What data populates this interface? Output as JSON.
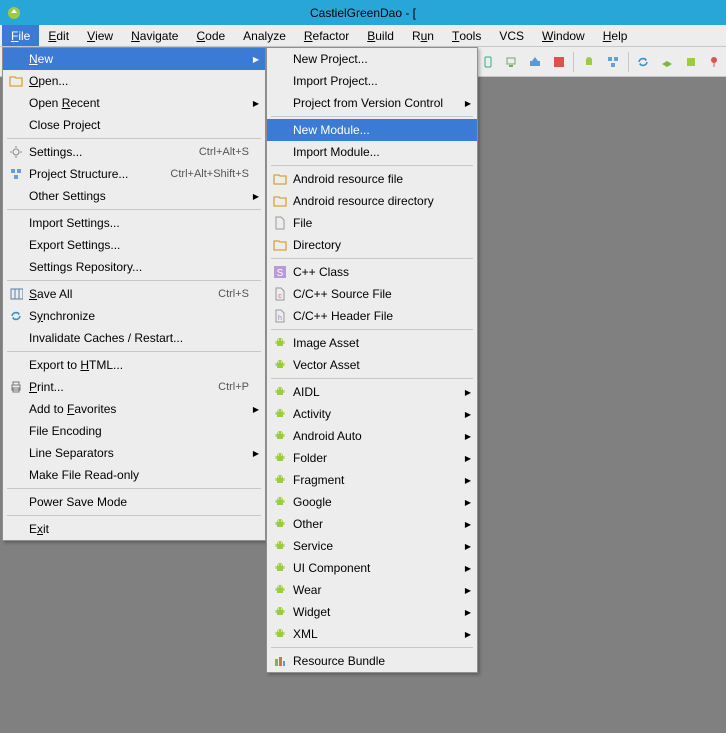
{
  "title": "CastielGreenDao - [",
  "menubar": [
    "File",
    "Edit",
    "View",
    "Navigate",
    "Code",
    "Analyze",
    "Refactor",
    "Build",
    "Run",
    "Tools",
    "VCS",
    "Window",
    "Help"
  ],
  "menubar_mn": [
    "F",
    "E",
    "V",
    "N",
    "C",
    null,
    "R",
    "B",
    "u",
    "T",
    null,
    "W",
    "H"
  ],
  "file_menu": [
    {
      "icon": "none",
      "label": "New",
      "mn": "N",
      "shortcut": "",
      "arrow": true,
      "hl": true
    },
    {
      "icon": "folder",
      "label": "Open...",
      "mn": "O",
      "shortcut": "",
      "arrow": false
    },
    {
      "icon": "none",
      "label": "Open Recent",
      "mn": "R",
      "shortcut": "",
      "arrow": true
    },
    {
      "icon": "none",
      "label": "Close Project",
      "mn": "",
      "shortcut": "",
      "arrow": false
    },
    {
      "sep": true
    },
    {
      "icon": "gear",
      "label": "Settings...",
      "mn": "",
      "shortcut": "Ctrl+Alt+S",
      "arrow": false
    },
    {
      "icon": "struct",
      "label": "Project Structure...",
      "mn": "",
      "shortcut": "Ctrl+Alt+Shift+S",
      "arrow": false
    },
    {
      "icon": "none",
      "label": "Other Settings",
      "mn": "",
      "shortcut": "",
      "arrow": true
    },
    {
      "sep": true
    },
    {
      "icon": "none",
      "label": "Import Settings...",
      "mn": "",
      "shortcut": "",
      "arrow": false
    },
    {
      "icon": "none",
      "label": "Export Settings...",
      "mn": "",
      "shortcut": "",
      "arrow": false
    },
    {
      "icon": "none",
      "label": "Settings Repository...",
      "mn": "",
      "shortcut": "",
      "arrow": false
    },
    {
      "sep": true
    },
    {
      "icon": "save",
      "label": "Save All",
      "mn": "S",
      "shortcut": "Ctrl+S",
      "arrow": false
    },
    {
      "icon": "sync",
      "label": "Synchronize",
      "mn": "y",
      "shortcut": "",
      "arrow": false
    },
    {
      "icon": "none",
      "label": "Invalidate Caches / Restart...",
      "mn": "",
      "shortcut": "",
      "arrow": false
    },
    {
      "sep": true
    },
    {
      "icon": "none",
      "label": "Export to HTML...",
      "mn": "H",
      "shortcut": "",
      "arrow": false
    },
    {
      "icon": "print",
      "label": "Print...",
      "mn": "P",
      "shortcut": "Ctrl+P",
      "arrow": false
    },
    {
      "icon": "none",
      "label": "Add to Favorites",
      "mn": "F",
      "shortcut": "",
      "arrow": true
    },
    {
      "icon": "none",
      "label": "File Encoding",
      "mn": "",
      "shortcut": "",
      "arrow": false
    },
    {
      "icon": "none",
      "label": "Line Separators",
      "mn": "",
      "shortcut": "",
      "arrow": true
    },
    {
      "icon": "none",
      "label": "Make File Read-only",
      "mn": "",
      "shortcut": "",
      "arrow": false
    },
    {
      "sep": true
    },
    {
      "icon": "none",
      "label": "Power Save Mode",
      "mn": "",
      "shortcut": "",
      "arrow": false
    },
    {
      "sep": true
    },
    {
      "icon": "none",
      "label": "Exit",
      "mn": "x",
      "shortcut": "",
      "arrow": false
    }
  ],
  "new_menu": [
    {
      "icon": "none",
      "label": "New Project...",
      "arrow": false
    },
    {
      "icon": "none",
      "label": "Import Project...",
      "arrow": false
    },
    {
      "icon": "none",
      "label": "Project from Version Control",
      "arrow": true
    },
    {
      "sep": true
    },
    {
      "icon": "none",
      "label": "New Module...",
      "arrow": false,
      "hl": true
    },
    {
      "icon": "none",
      "label": "Import Module...",
      "arrow": false
    },
    {
      "sep": true
    },
    {
      "icon": "folder",
      "label": "Android resource file",
      "arrow": false
    },
    {
      "icon": "folder",
      "label": "Android resource directory",
      "arrow": false
    },
    {
      "icon": "file",
      "label": "File",
      "arrow": false
    },
    {
      "icon": "folder",
      "label": "Directory",
      "arrow": false
    },
    {
      "sep": true
    },
    {
      "icon": "s",
      "label": "C++ Class",
      "arrow": false
    },
    {
      "icon": "cfile",
      "label": "C/C++ Source File",
      "arrow": false
    },
    {
      "icon": "hfile",
      "label": "C/C++ Header File",
      "arrow": false
    },
    {
      "sep": true
    },
    {
      "icon": "android",
      "label": "Image Asset",
      "arrow": false
    },
    {
      "icon": "android",
      "label": "Vector Asset",
      "arrow": false
    },
    {
      "sep": true
    },
    {
      "icon": "android",
      "label": "AIDL",
      "arrow": true
    },
    {
      "icon": "android",
      "label": "Activity",
      "arrow": true
    },
    {
      "icon": "android",
      "label": "Android Auto",
      "arrow": true
    },
    {
      "icon": "android",
      "label": "Folder",
      "arrow": true
    },
    {
      "icon": "android",
      "label": "Fragment",
      "arrow": true
    },
    {
      "icon": "android",
      "label": "Google",
      "arrow": true
    },
    {
      "icon": "android",
      "label": "Other",
      "arrow": true
    },
    {
      "icon": "android",
      "label": "Service",
      "arrow": true
    },
    {
      "icon": "android",
      "label": "UI Component",
      "arrow": true
    },
    {
      "icon": "android",
      "label": "Wear",
      "arrow": true
    },
    {
      "icon": "android",
      "label": "Widget",
      "arrow": true
    },
    {
      "icon": "android",
      "label": "XML",
      "arrow": true
    },
    {
      "sep": true
    },
    {
      "icon": "bundle",
      "label": "Resource Bundle",
      "arrow": false
    }
  ],
  "toolbar_icons": [
    "phone",
    "avd",
    "sdk",
    "stop",
    "sep",
    "ddms",
    "struct",
    "sep",
    "sync",
    "ship",
    "box",
    "pin"
  ]
}
